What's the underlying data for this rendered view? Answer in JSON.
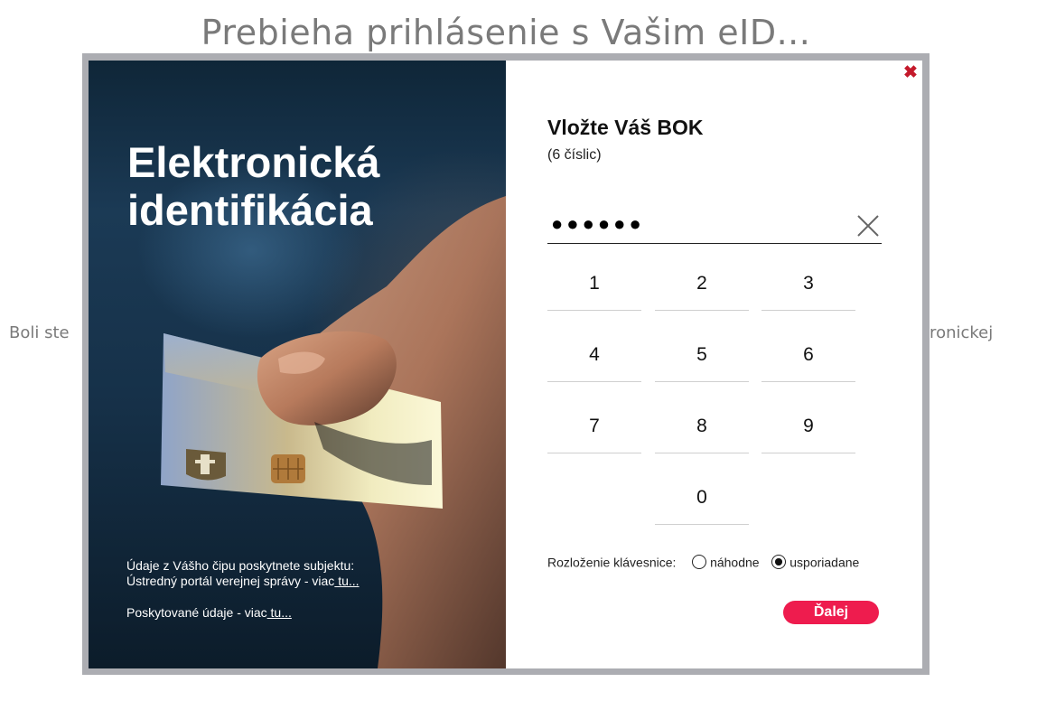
{
  "background": {
    "title": "Prebieha prihlásenie s Vašim eID...",
    "text_left": "Boli ste",
    "text_right": "tronickej"
  },
  "left_panel": {
    "title_line1": "Elektronická",
    "title_line2": "identifikácia",
    "info_line1": "Údaje z Vášho čipu poskytnete subjektu:",
    "info_line2": "Ústredný portál verejnej správy - viac",
    "info_link1": " tu...",
    "info_line3": "Poskytované údaje - viac",
    "info_link2": " tu..."
  },
  "dialog": {
    "close_icon": "close-icon",
    "heading": "Vložte Váš BOK",
    "subheading": "(6 číslic)",
    "pin_value": "●●●●●●",
    "keypad": [
      "1",
      "2",
      "3",
      "4",
      "5",
      "6",
      "7",
      "8",
      "9",
      "0"
    ],
    "layout_label": "Rozloženie klávesnice:",
    "layout_options": [
      "náhodne",
      "usporiadane"
    ],
    "layout_selected": "usporiadane",
    "next_label": "Ďalej"
  },
  "colors": {
    "accent": "#ee1c4e",
    "close": "#c4192b",
    "frame": "#acadb2",
    "panel_dark": "#163149"
  }
}
